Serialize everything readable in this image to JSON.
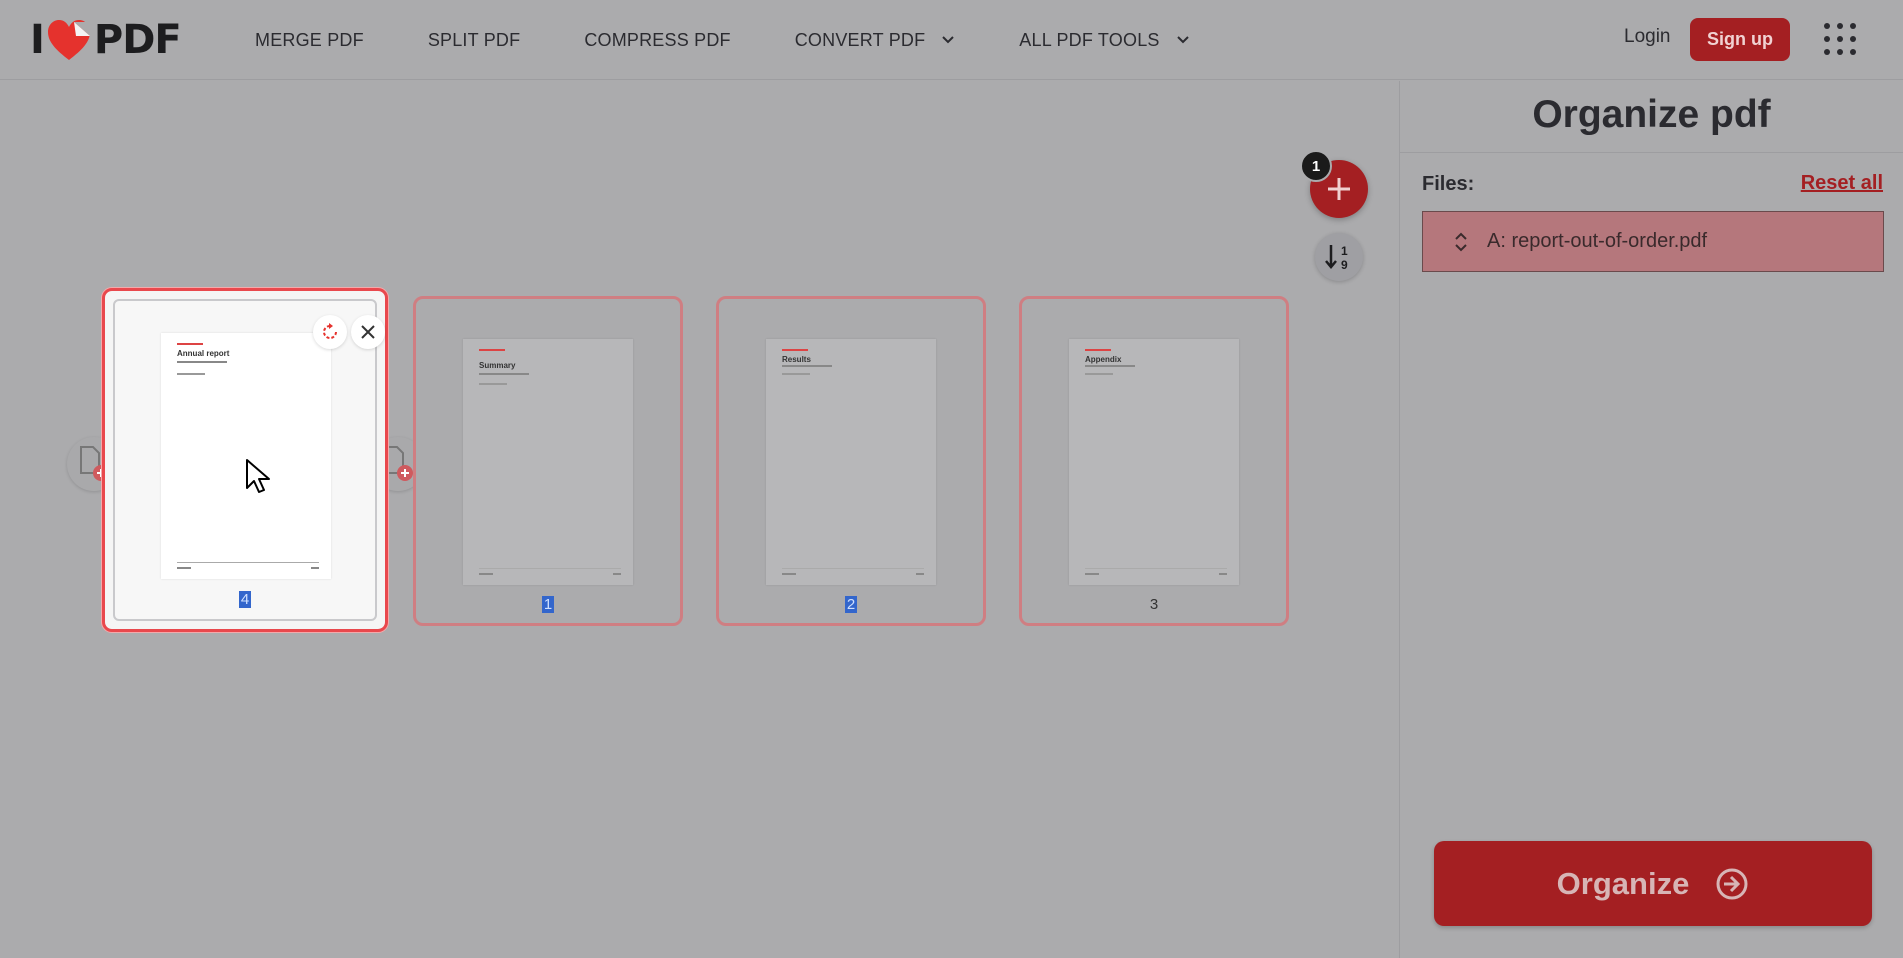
{
  "header": {
    "logo_left": "I",
    "logo_right": "PDF",
    "nav": [
      {
        "label": "MERGE PDF"
      },
      {
        "label": "SPLIT PDF"
      },
      {
        "label": "COMPRESS PDF"
      },
      {
        "label": "CONVERT PDF"
      },
      {
        "label": "ALL PDF TOOLS"
      }
    ],
    "login_label": "Login",
    "signup_label": "Sign up"
  },
  "workspace": {
    "files_badge": "1",
    "pages": [
      {
        "title": "Annual report",
        "number": "4",
        "selected": true
      },
      {
        "title": "Summary",
        "number": "1",
        "selected": true
      },
      {
        "title": "Results",
        "number": "2",
        "selected": true
      },
      {
        "title": "Appendix",
        "number": "3",
        "selected": false
      }
    ]
  },
  "sidebar": {
    "title": "Organize pdf",
    "files_label": "Files:",
    "reset_label": "Reset all",
    "file_name": "A: report-out-of-order.pdf",
    "organize_label": "Organize"
  },
  "colors": {
    "brand_red": "#a41f22",
    "active_border": "#e9484d",
    "selection_blue": "#3366cc"
  }
}
